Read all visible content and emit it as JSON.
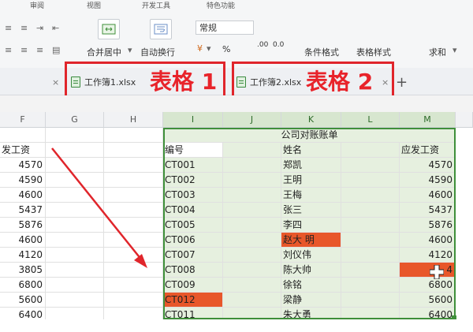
{
  "ribbon": {
    "menu_top": [
      "审阅",
      "视图",
      "开发工具",
      "特色功能"
    ],
    "merge_label": "合并居中",
    "wrap_label": "自动换行",
    "format_combo": "常规",
    "percent_label": "%",
    "decimals_label": ".00",
    "decimals_label2": "0.0",
    "cond_format_label": "条件格式",
    "table_style_label": "表格样式",
    "sum_label": "求和"
  },
  "tabs": {
    "tab1": "工作簿1.xlsx",
    "tab2": "工作簿2.xlsx",
    "close": "×",
    "add": "+"
  },
  "annotations": {
    "label1": "表格 1",
    "label2": "表格 2"
  },
  "columns": [
    "F",
    "G",
    "H",
    "I",
    "J",
    "K",
    "L",
    "M"
  ],
  "left_table": {
    "header_partial": "发工资",
    "values": [
      "4570",
      "4590",
      "4600",
      "5437",
      "5876",
      "4600",
      "4120",
      "3805",
      "6800",
      "5600",
      "6400"
    ]
  },
  "right_table": {
    "title": "公司对账账单",
    "headers": [
      "编号",
      "姓名",
      "应发工资"
    ],
    "rows": [
      {
        "id": "CT001",
        "name": "郑凯",
        "salary": "4570"
      },
      {
        "id": "CT002",
        "name": "王明",
        "salary": "4590"
      },
      {
        "id": "CT003",
        "name": "王梅",
        "salary": "4600"
      },
      {
        "id": "CT004",
        "name": "张三",
        "salary": "5437"
      },
      {
        "id": "CT005",
        "name": "李四",
        "salary": "5876"
      },
      {
        "id": "CT006",
        "name": "赵大 明",
        "salary": "4600"
      },
      {
        "id": "CT007",
        "name": "刘仪伟",
        "salary": "4120"
      },
      {
        "id": "CT008",
        "name": "陈大帅",
        "salary": "4"
      },
      {
        "id": "CT009",
        "name": "徐铭",
        "salary": "6800"
      },
      {
        "id": "CT012",
        "name": "梁静",
        "salary": "5600"
      },
      {
        "id": "CT011",
        "name": "朱大勇",
        "salary": "6400"
      }
    ]
  },
  "colors": {
    "accent_red": "#e0252b",
    "highlight_orange": "#e8572a",
    "selection_green": "#3f8f3a"
  }
}
